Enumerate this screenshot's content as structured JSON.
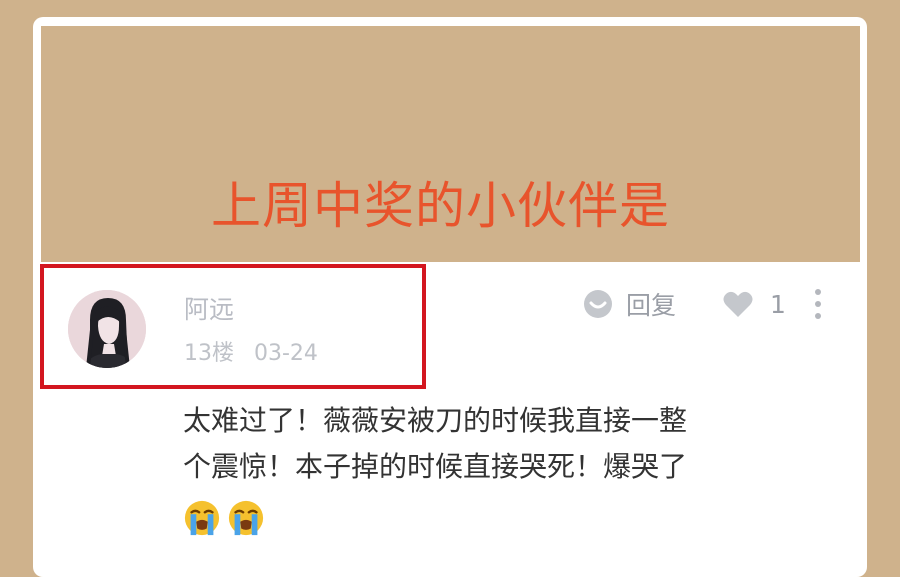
{
  "banner": {
    "title": "上周中奖的小伙伴是"
  },
  "comment": {
    "username": "阿远",
    "floor": "13楼",
    "date": "03-24",
    "reply_label": "回复",
    "like_count": "1",
    "lines": [
      "太难过了！薇薇安被刀的时候我直接一整",
      "个震惊！本子掉的时候直接哭死！爆哭了"
    ],
    "emojis": [
      "loudly-crying-face-icon",
      "loudly-crying-face-icon"
    ]
  },
  "colors": {
    "background": "#cfb28c",
    "banner_text": "#e8542c",
    "highlight_border": "#d3161f",
    "meta_text": "#bfc2c8",
    "body_text": "#333333"
  }
}
